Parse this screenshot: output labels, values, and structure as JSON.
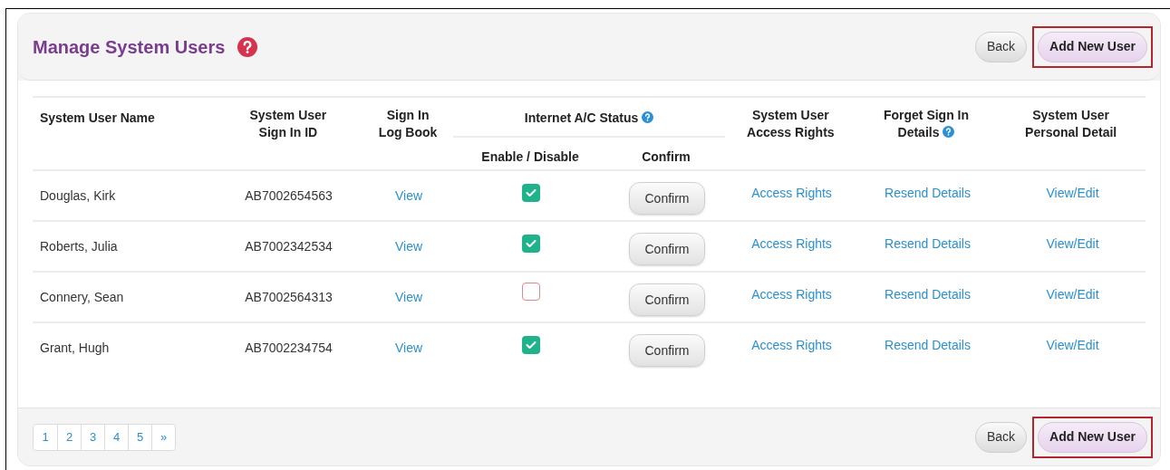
{
  "title": "Manage System Users",
  "header_buttons": [
    {
      "label": "Back",
      "kind": "secondary",
      "highlighted": false
    },
    {
      "label": "Add New User",
      "kind": "primary",
      "highlighted": true
    }
  ],
  "table": {
    "columns": [
      {
        "label": "System User Name"
      },
      {
        "label": "System User Sign In ID"
      },
      {
        "label": "Sign In Log Book"
      },
      {
        "label": "Internet A/C Status",
        "help": true,
        "subcolumns": [
          "Enable / Disable",
          "Confirm"
        ]
      },
      {
        "label": "System User Access Rights"
      },
      {
        "label": "Forget Sign In Details",
        "help": true
      },
      {
        "label": "System User Personal Detail"
      }
    ],
    "rows": [
      {
        "name": "Douglas, Kirk",
        "sign_in_id": "AB7002654563",
        "log_book": "View",
        "enabled": true,
        "confirm": "Confirm",
        "access_rights": "Access Rights",
        "forget": "Resend Details",
        "personal": "View/Edit"
      },
      {
        "name": "Roberts, Julia",
        "sign_in_id": "AB7002342534",
        "log_book": "View",
        "enabled": true,
        "confirm": "Confirm",
        "access_rights": "Access Rights",
        "forget": "Resend Details",
        "personal": "View/Edit"
      },
      {
        "name": "Connery, Sean",
        "sign_in_id": "AB7002564313",
        "log_book": "View",
        "enabled": false,
        "confirm": "Confirm",
        "access_rights": "Access Rights",
        "forget": "Resend Details",
        "personal": "View/Edit"
      },
      {
        "name": "Grant, Hugh",
        "sign_in_id": "AB7002234754",
        "log_book": "View",
        "enabled": true,
        "confirm": "Confirm",
        "access_rights": "Access Rights",
        "forget": "Resend Details",
        "personal": "View/Edit"
      }
    ]
  },
  "pagination": [
    "1",
    "2",
    "3",
    "4",
    "5",
    "»"
  ],
  "footer_buttons": [
    {
      "label": "Back",
      "kind": "secondary",
      "highlighted": false
    },
    {
      "label": "Add New User",
      "kind": "primary",
      "highlighted": true
    }
  ]
}
